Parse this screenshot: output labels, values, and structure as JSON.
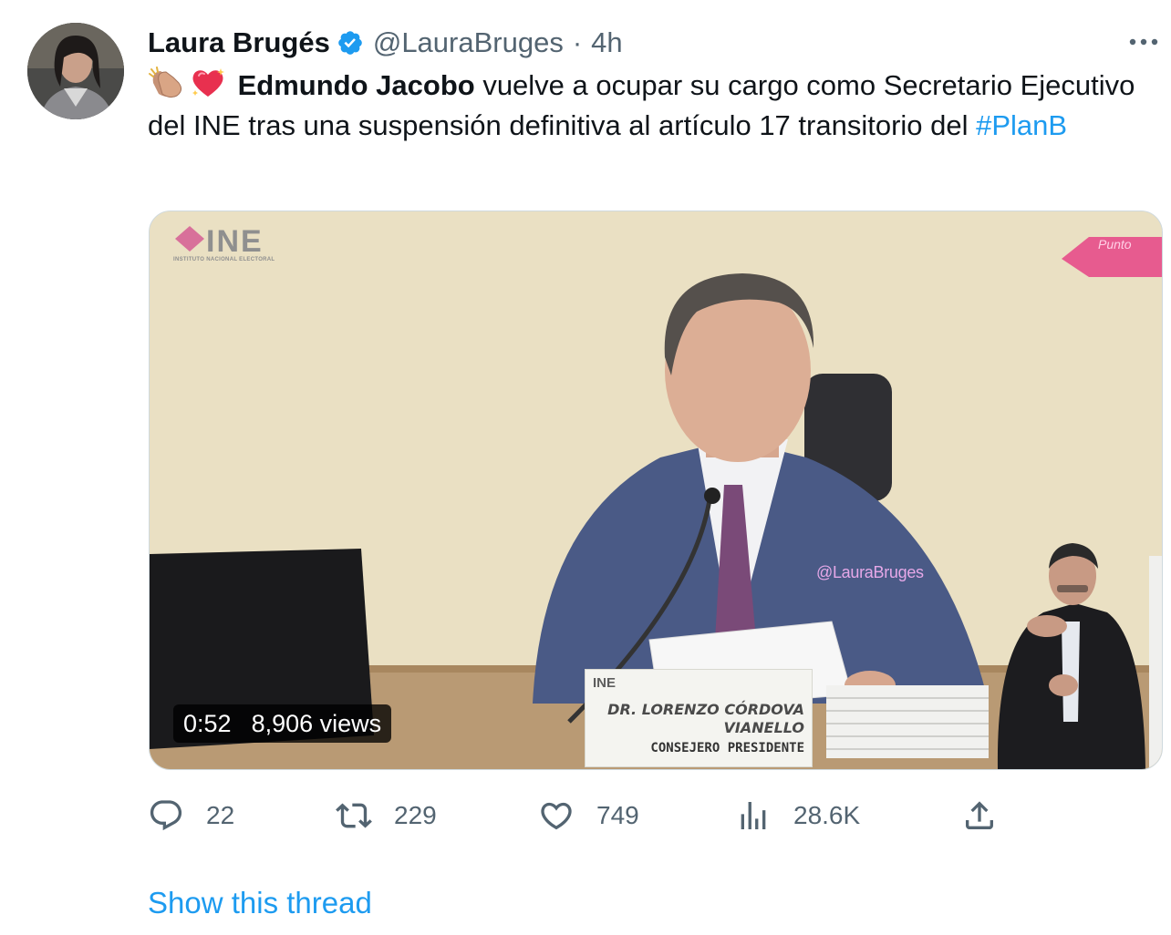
{
  "tweet": {
    "author": {
      "display_name": "Laura Brugés",
      "handle": "@LauraBruges",
      "separator": "·",
      "time": "4h",
      "verified": true
    },
    "text": {
      "emojis": [
        "clapping-hands-emoji",
        "sparkling-heart-emoji"
      ],
      "mention_bold": "Edmundo Jacobo",
      "body": " vuelve a ocupar su cargo como Secretario Ejecutivo del INE tras una suspensión definitiva al artículo 17 transitorio del ",
      "hashtag": "#PlanB"
    },
    "media": {
      "type": "video",
      "duration": "0:52",
      "views": "8,906 views",
      "overlay_logo": "INE",
      "overlay_logo_sub": "INSTITUTO NACIONAL ELECTORAL",
      "watermark": "@LauraBruges",
      "corner_label": "Punto",
      "nameplate": {
        "logo": "INE",
        "line1": "DR. LORENZO CÓRDOVA",
        "line2": "VIANELLO",
        "line3": "CONSEJERO PRESIDENTE"
      }
    },
    "actions": {
      "replies": "22",
      "retweets": "229",
      "likes": "749",
      "views": "28.6K"
    },
    "show_thread": "Show this thread"
  },
  "colors": {
    "text_primary": "#0f1419",
    "text_secondary": "#536471",
    "accent": "#1d9bf0",
    "border": "#cfd9de"
  }
}
